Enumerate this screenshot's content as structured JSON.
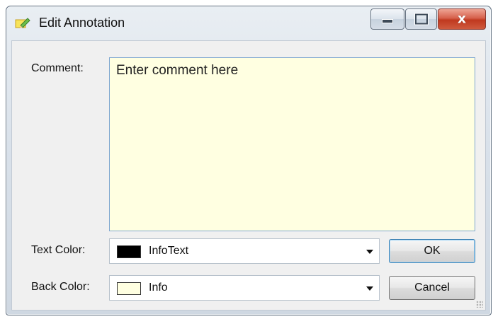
{
  "window": {
    "title": "Edit Annotation",
    "controls": {
      "minimize": "minimize",
      "maximize": "maximize",
      "close": "x"
    }
  },
  "form": {
    "comment": {
      "label": "Comment:",
      "value": "Enter comment here"
    },
    "text_color": {
      "label": "Text Color:",
      "value": "InfoText",
      "swatch": "#000000"
    },
    "back_color": {
      "label": "Back Color:",
      "value": "Info",
      "swatch": "#ffffe1"
    }
  },
  "buttons": {
    "ok": "OK",
    "cancel": "Cancel"
  },
  "icons": {
    "title": "edit-note-icon",
    "dropdown": "chevron-down-icon",
    "resize": "resize-grip-icon"
  }
}
